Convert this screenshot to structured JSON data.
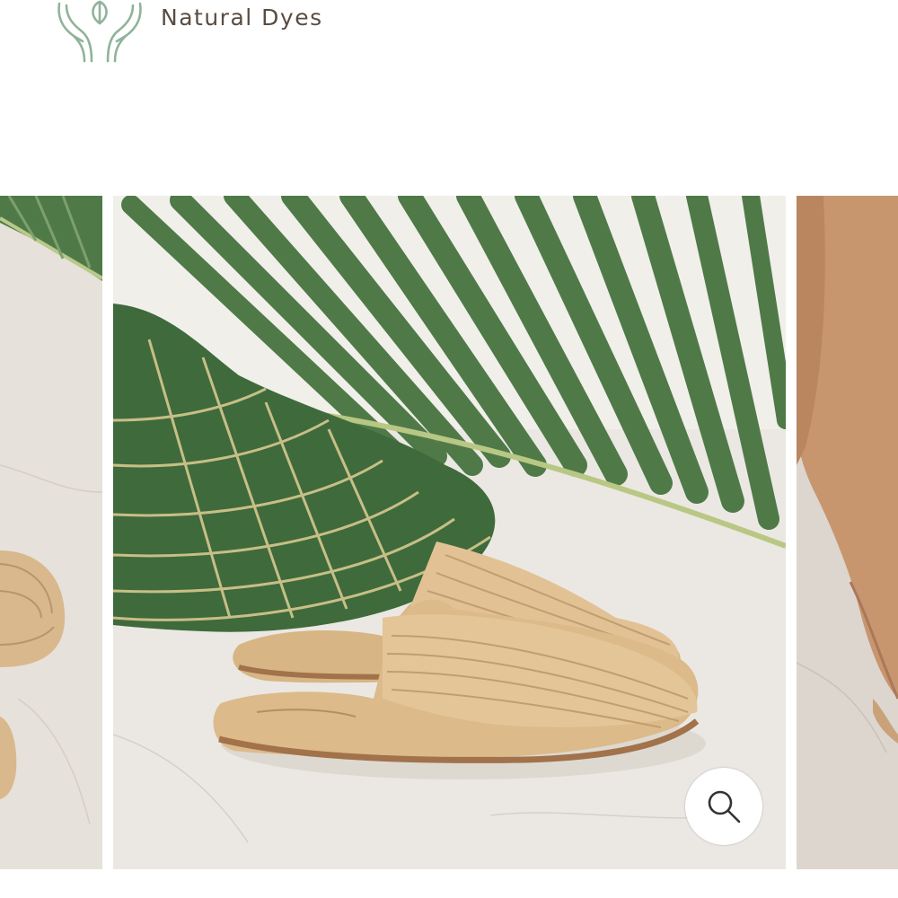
{
  "badge": {
    "label": "Natural Dyes",
    "icon": "hands-leaf-icon",
    "icon_color": "#8fb39a",
    "text_color": "#5a4c40"
  },
  "gallery": {
    "slides": [
      {
        "name": "previous-product-image",
        "state": "partially-visible"
      },
      {
        "name": "current-product-image",
        "state": "active",
        "description_icon": "raffia-mule-slippers"
      },
      {
        "name": "next-product-image",
        "state": "partially-visible"
      }
    ],
    "zoom_button": {
      "icon": "magnifier-icon"
    }
  },
  "colors": {
    "palm_green": "#4f7a48",
    "raffia": "#d8b78c",
    "floor": "#e8e4de",
    "background": "#ffffff"
  }
}
